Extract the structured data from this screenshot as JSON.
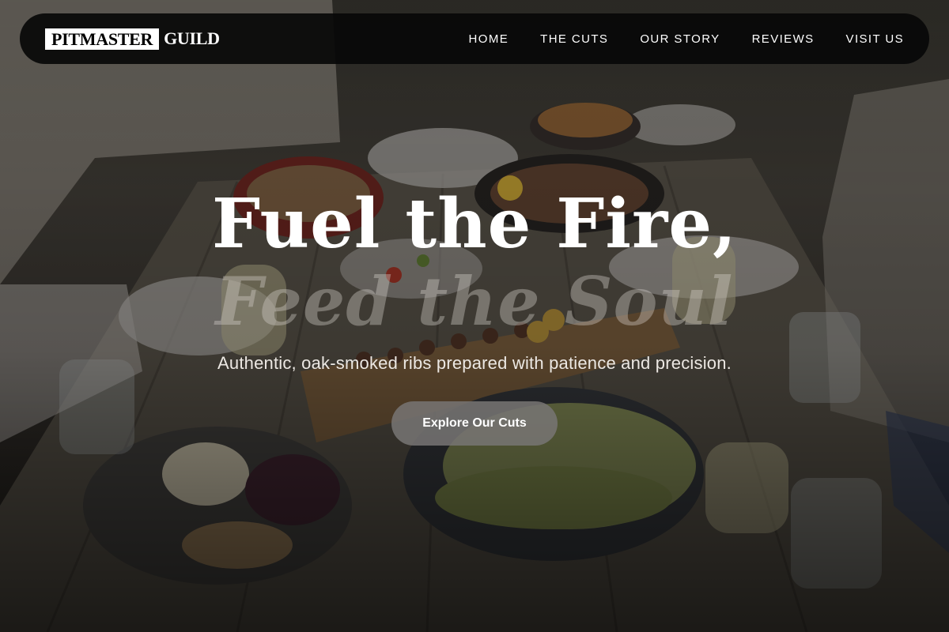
{
  "brand": {
    "logo_boxed": "PITMASTER",
    "logo_rest": "GUILD"
  },
  "nav": {
    "items": [
      {
        "label": "HOME"
      },
      {
        "label": "THE CUTS"
      },
      {
        "label": "OUR STORY"
      },
      {
        "label": "REVIEWS"
      },
      {
        "label": "VISIT US"
      }
    ]
  },
  "hero": {
    "title": "Fuel the Fire,",
    "subtitle": "Feed the Soul",
    "tagline": "Authentic, oak-smoked ribs prepared with patience and precision.",
    "cta_label": "Explore Our Cuts",
    "background_image": "outdoor-dinner-table-photo"
  },
  "colors": {
    "navbar_bg": "#080808",
    "cta_bg": "#787674",
    "text": "#ffffff"
  }
}
